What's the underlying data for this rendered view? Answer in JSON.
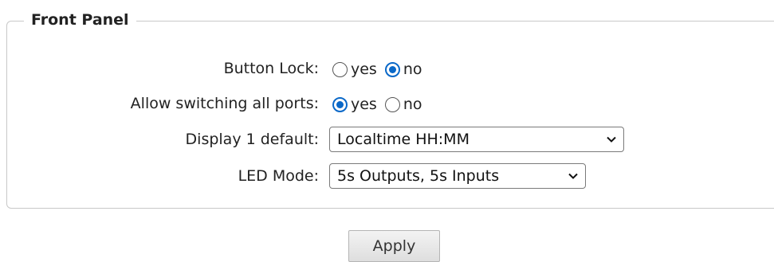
{
  "panel": {
    "title": "Front Panel"
  },
  "button_lock": {
    "label": "Button Lock:",
    "options": [
      {
        "label": "yes",
        "checked": false
      },
      {
        "label": "no",
        "checked": true
      }
    ]
  },
  "allow_switching": {
    "label": "Allow switching all ports:",
    "options": [
      {
        "label": "yes",
        "checked": true
      },
      {
        "label": "no",
        "checked": false
      }
    ]
  },
  "display1_default": {
    "label": "Display 1 default:",
    "value": "Localtime HH:MM"
  },
  "led_mode": {
    "label": "LED Mode:",
    "value": "5s Outputs, 5s Inputs"
  },
  "apply_label": "Apply",
  "colors": {
    "radio_checked": "#0a68c8",
    "frame_border": "#c8c8c8"
  }
}
